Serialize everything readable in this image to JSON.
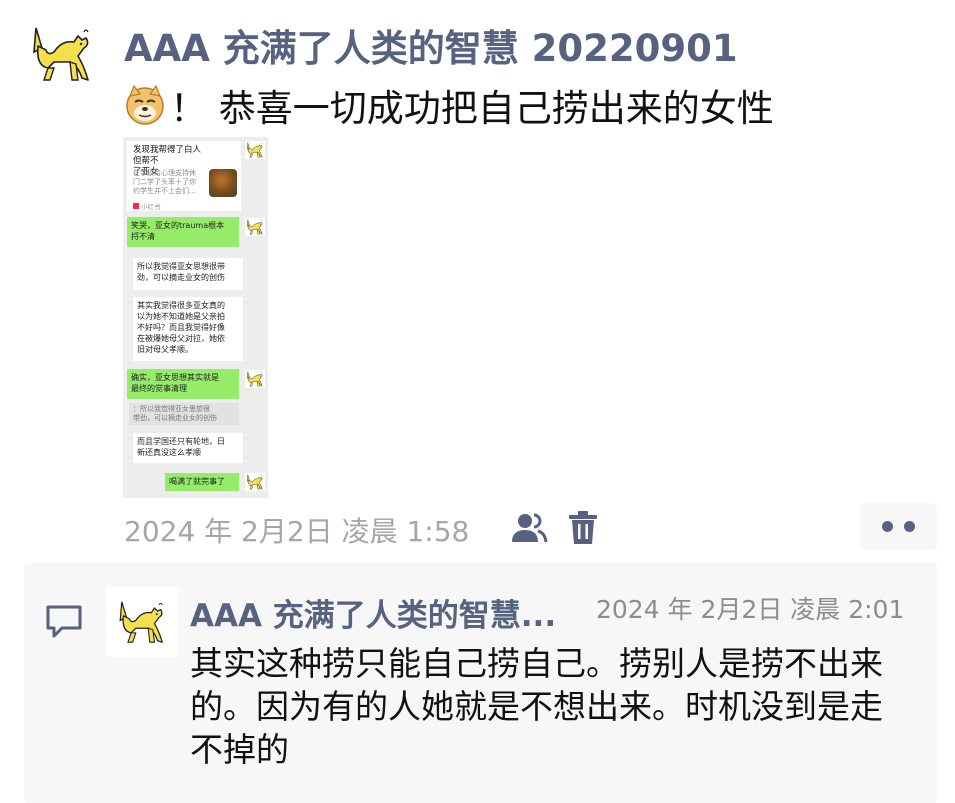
{
  "post": {
    "author": "AAA 充满了人类的智慧 20220901",
    "emoji_icon": "doge-face-icon",
    "text": "！ 恭喜一切成功把自己捞出来的女性",
    "timestamp": "2024 年 2月2日 凌晨 1:58",
    "visibility_icon": "people-icon",
    "delete_icon": "trash-icon",
    "more_icon": "more-dots-icon"
  },
  "screenshot": {
    "card": {
      "title": "发现我帮得了白人但帮不\n了亚女",
      "subtitle": "在学校给心理支持休\n门二学了头率十了你\n约学生并不上会们…",
      "source": "小红书"
    },
    "messages": [
      {
        "side": "right",
        "text": "笑哭，亚女的trauma根本\n捋不清"
      },
      {
        "side": "left",
        "text": "所以我觉得亚女思想很带\n劲，可以摘走业女的创伤"
      },
      {
        "side": "left",
        "text": "其实我觉得很多亚女真的\n以为她不知道她是父亲拍\n不好吗？而且我觉得好像\n在被爆她母父对拉，她依\n旧对母父孝顺。"
      },
      {
        "side": "right",
        "text": "确实，亚女思想其实就是\n最终的觉事清理"
      },
      {
        "side": "left",
        "text": "而且学国还只有轮地，日\n新还真没这么孝顺"
      },
      {
        "side": "right",
        "text": "喝满了就完事了"
      }
    ],
    "quote": "：所以我觉得亚女思想很\n带劲，可以摘走业女的创伤"
  },
  "comment": {
    "icon": "comment-icon",
    "author": "AAA 充满了人类的智慧...",
    "timestamp": "2024 年 2月2日 凌晨 2:01",
    "text": "其实这种捞只能自己捞自己。捞别人是捞不出来的。因为有的人她就是不想出来。时机没到是走不掉的"
  },
  "colors": {
    "name_blue": "#56627f",
    "timestamp_gray": "#a6a6a6",
    "wechat_green": "#95ec69",
    "panel_bg": "#f7f7f7"
  }
}
